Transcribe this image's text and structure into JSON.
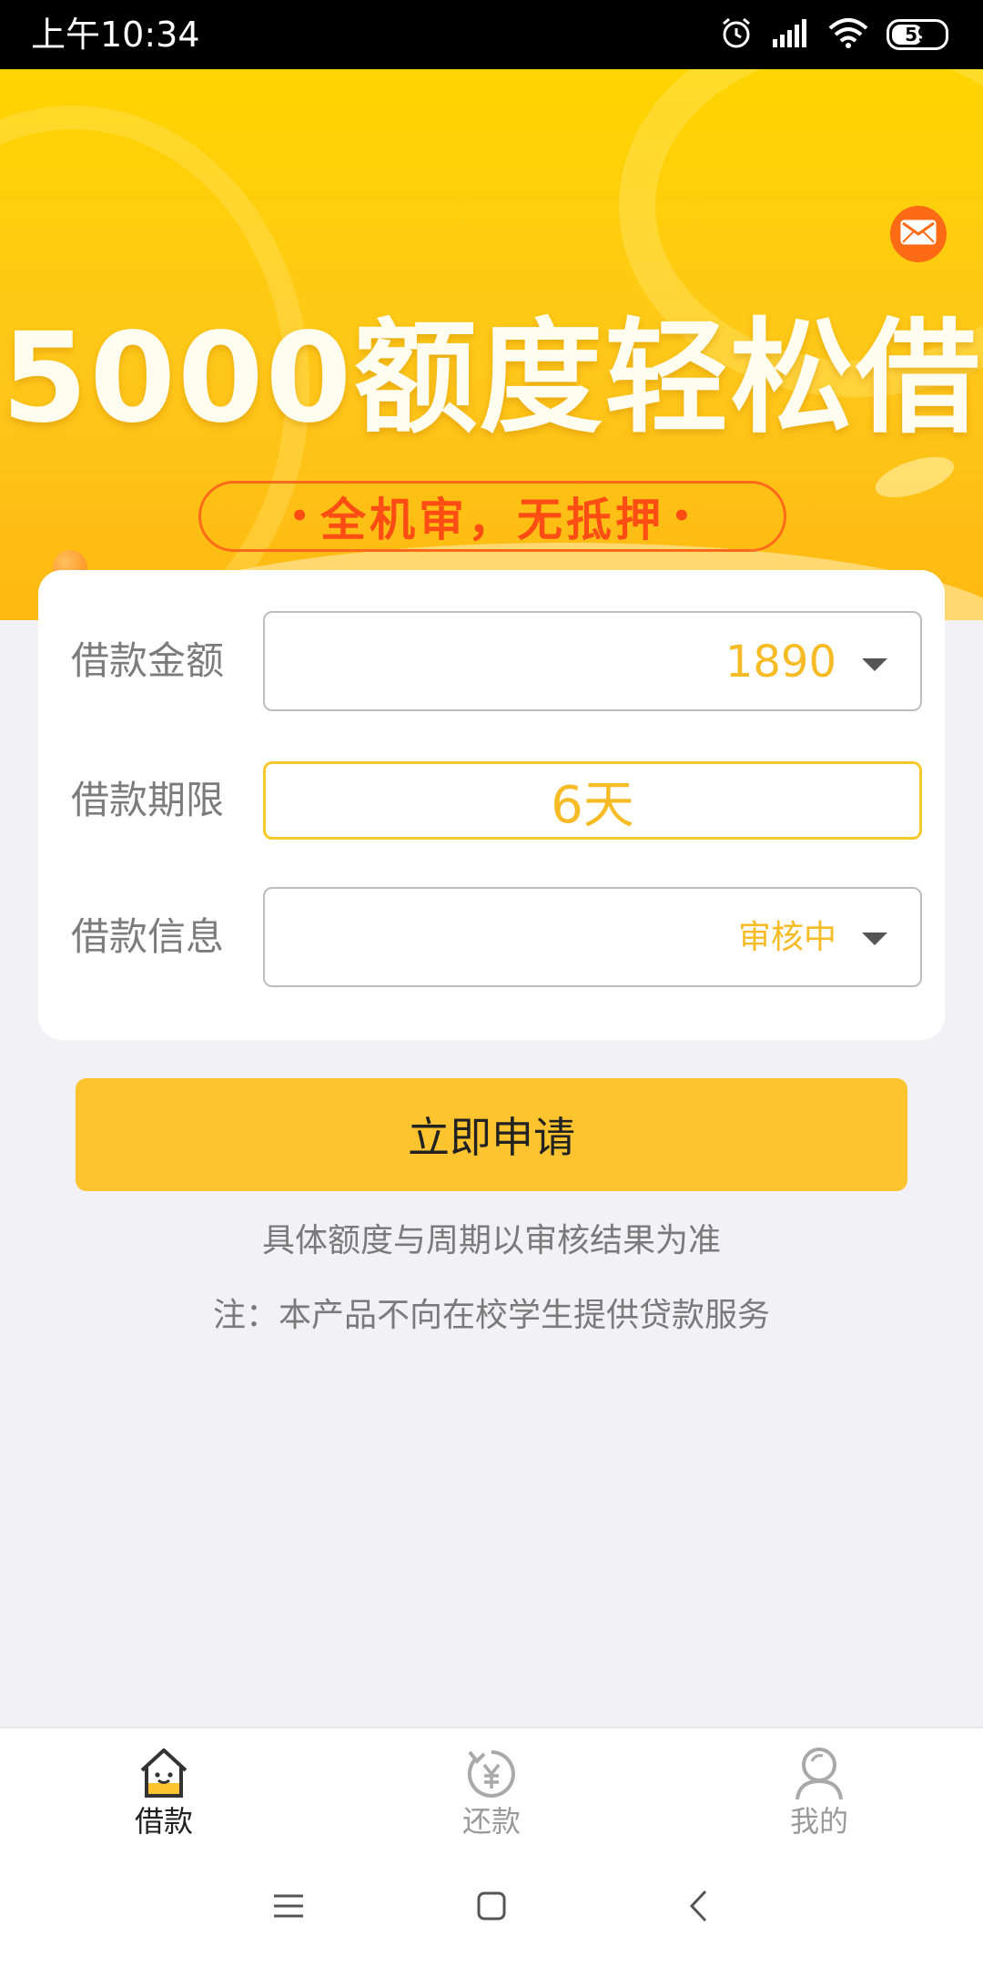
{
  "status_bar": {
    "time": "上午10:34",
    "battery": "59",
    "battery_level": 0.59
  },
  "banner": {
    "headline": "5000额度轻松借",
    "subtitle": "全机审，无抵押",
    "mail_icon": "mail-icon"
  },
  "form": {
    "amount": {
      "label": "借款金额",
      "value": "1890"
    },
    "period": {
      "label": "借款期限",
      "value": "6天"
    },
    "info": {
      "label": "借款信息",
      "value": "审核中"
    }
  },
  "apply_button": "立即申请",
  "notes": {
    "line1": "具体额度与周期以审核结果为准",
    "line2": "注：本产品不向在校学生提供贷款服务"
  },
  "tabs": [
    {
      "label": "借款",
      "icon": "house-icon",
      "active": true
    },
    {
      "label": "还款",
      "icon": "repay-yen-icon",
      "active": false
    },
    {
      "label": "我的",
      "icon": "person-icon",
      "active": false
    }
  ],
  "colors": {
    "accent": "#fec42f",
    "value_text": "#f7bb25",
    "banner_pill": "#ff4d14"
  }
}
